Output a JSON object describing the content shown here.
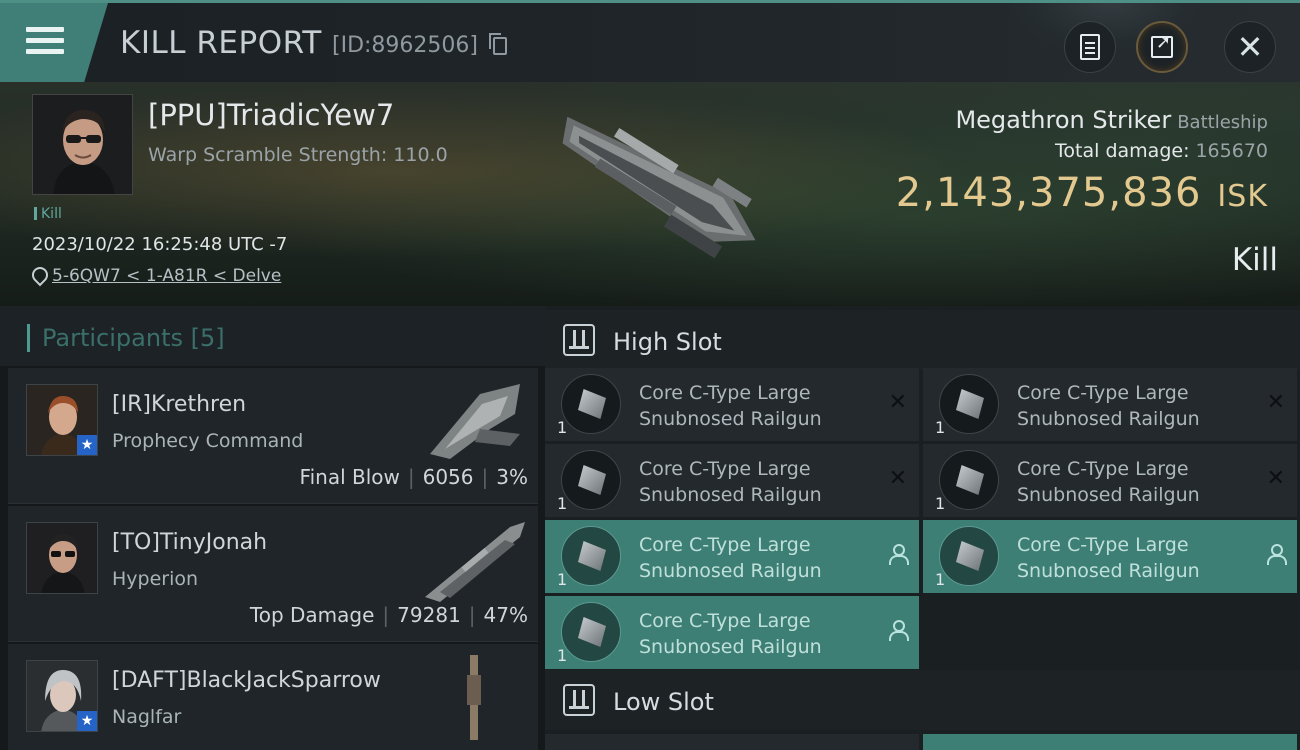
{
  "header": {
    "title": "KILL REPORT",
    "report_id": "[ID:8962506]",
    "buttons": [
      "document-icon",
      "share-icon",
      "close-icon"
    ]
  },
  "victim": {
    "name": "[PPU]TriadicYew7",
    "warp_scramble": "Warp Scramble Strength: 110.0",
    "tag": "Kill",
    "timestamp": "2023/10/22 16:25:48 UTC -7",
    "location": "5-6QW7 < 1-A81R < Delve",
    "ship_name": "Megathron Striker",
    "ship_class": "Battleship",
    "total_damage_label": "Total damage:",
    "total_damage_value": "165670",
    "isk_value": "2,143,375,836",
    "isk_unit": "ISK",
    "result": "Kill"
  },
  "participants": {
    "header": "Participants [5]",
    "items": [
      {
        "name": "[IR]Krethren",
        "ship": "Prophecy Command",
        "role": "Final Blow",
        "damage": "6056",
        "percent": "3%"
      },
      {
        "name": "[TO]TinyJonah",
        "ship": "Hyperion",
        "role": "Top Damage",
        "damage": "79281",
        "percent": "47%"
      },
      {
        "name": "[DAFT]BlackJackSparrow",
        "ship": "Naglfar",
        "role": "",
        "damage": "",
        "percent": ""
      }
    ]
  },
  "slots": {
    "high": {
      "title": "High Slot",
      "modules": [
        {
          "qty": "1",
          "line1": "Core C-Type Large",
          "line2": "Snubnosed Railgun",
          "state": "destroyed"
        },
        {
          "qty": "1",
          "line1": "Core C-Type Large",
          "line2": "Snubnosed Railgun",
          "state": "destroyed"
        },
        {
          "qty": "1",
          "line1": "Core C-Type Large",
          "line2": "Snubnosed Railgun",
          "state": "destroyed"
        },
        {
          "qty": "1",
          "line1": "Core C-Type Large",
          "line2": "Snubnosed Railgun",
          "state": "destroyed"
        },
        {
          "qty": "1",
          "line1": "Core C-Type Large",
          "line2": "Snubnosed Railgun",
          "state": "dropped"
        },
        {
          "qty": "1",
          "line1": "Core C-Type Large",
          "line2": "Snubnosed Railgun",
          "state": "dropped"
        },
        {
          "qty": "1",
          "line1": "Core C-Type Large",
          "line2": "Snubnosed Railgun",
          "state": "dropped"
        }
      ]
    },
    "low": {
      "title": "Low Slot"
    }
  },
  "colors": {
    "accent": "#3d7f75",
    "isk": "#e3c98f",
    "background": "#15191c"
  }
}
